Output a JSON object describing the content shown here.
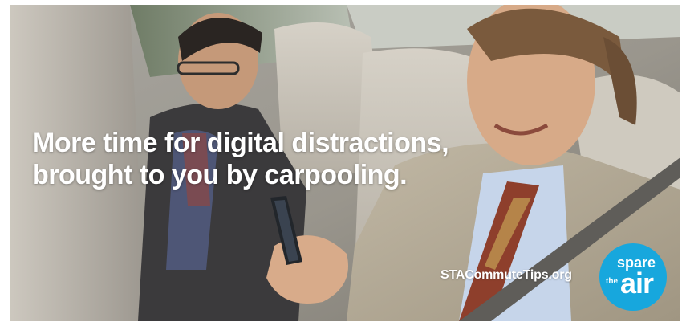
{
  "ad": {
    "headline_line1": "More time for digital distractions,",
    "headline_line2": "brought to you by carpooling.",
    "website": "STACommuteTips.org",
    "logo": {
      "spare": "spare",
      "the": "the",
      "air": "air",
      "color": "#17a7dd"
    }
  }
}
